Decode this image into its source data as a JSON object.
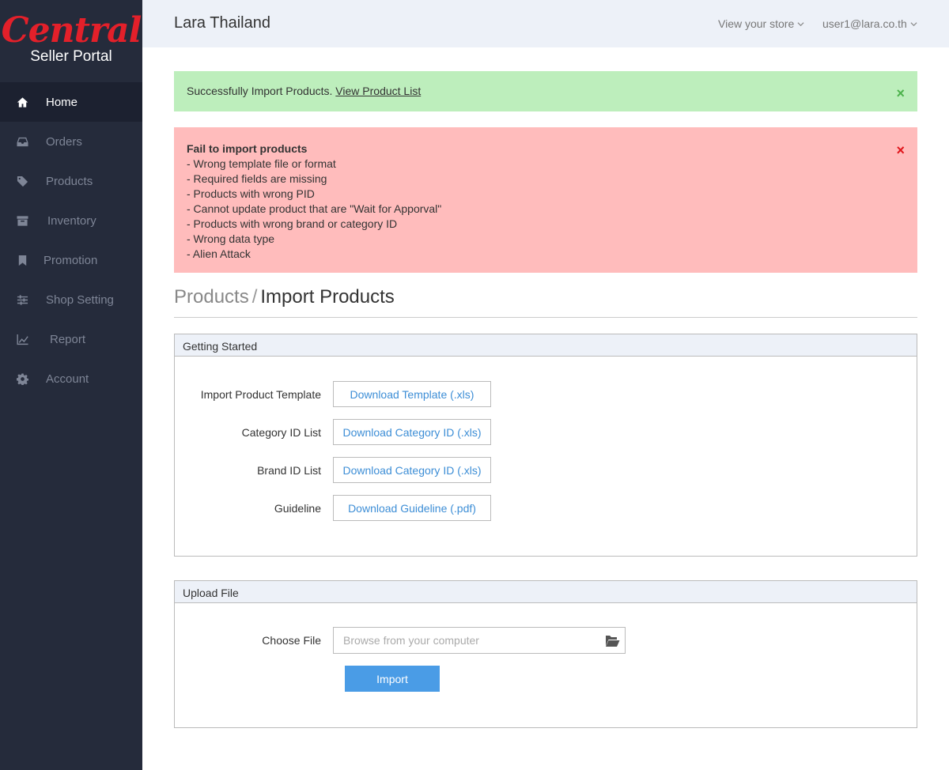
{
  "brand": {
    "logo": "Central",
    "subtitle": "Seller Portal"
  },
  "sidebar": {
    "items": [
      {
        "label": "Home",
        "icon": "home-icon",
        "active": true
      },
      {
        "label": "Orders",
        "icon": "inbox-icon"
      },
      {
        "label": "Products",
        "icon": "tag-icon"
      },
      {
        "label": "Inventory",
        "icon": "archive-icon"
      },
      {
        "label": "Promotion",
        "icon": "bookmark-icon"
      },
      {
        "label": "Shop Setting",
        "icon": "sliders-icon"
      },
      {
        "label": "Report",
        "icon": "line-chart-icon"
      },
      {
        "label": "Account",
        "icon": "gear-icon"
      }
    ]
  },
  "header": {
    "title": "Lara Thailand",
    "store_link": "View your store",
    "user_menu": "user1@lara.co.th"
  },
  "alerts": {
    "success": {
      "text": "Successfully Import Products. ",
      "link": "View Product List",
      "close": "×"
    },
    "error": {
      "title": "Fail to import products",
      "items": [
        "- Wrong template file or format",
        "- Required fields are missing",
        "- Products with wrong PID",
        "- Cannot update product that are \"Wait for Apporval\"",
        "- Products with wrong brand or category ID",
        "- Wrong data type",
        "- Alien Attack"
      ],
      "close": "×"
    }
  },
  "breadcrumb": {
    "parent": "Products",
    "separator": "/",
    "current": "Import Products"
  },
  "getting_started": {
    "title": "Getting Started",
    "rows": [
      {
        "label": "Import Product Template",
        "button": "Download Template (.xls)"
      },
      {
        "label": "Category ID List",
        "button": "Download Category ID (.xls)"
      },
      {
        "label": "Brand ID List",
        "button": "Download Category ID (.xls)"
      },
      {
        "label": "Guideline",
        "button": "Download Guideline (.pdf)"
      }
    ]
  },
  "upload": {
    "title": "Upload File",
    "label": "Choose File",
    "placeholder": "Browse from your computer",
    "import_button": "Import"
  },
  "colors": {
    "sidebar_bg": "#252b3b",
    "header_bg": "#edf1f8",
    "success_bg": "#bdeebc",
    "error_bg": "#ffbcbc",
    "accent": "#4a9ce6",
    "brand_red": "#e3202a"
  }
}
